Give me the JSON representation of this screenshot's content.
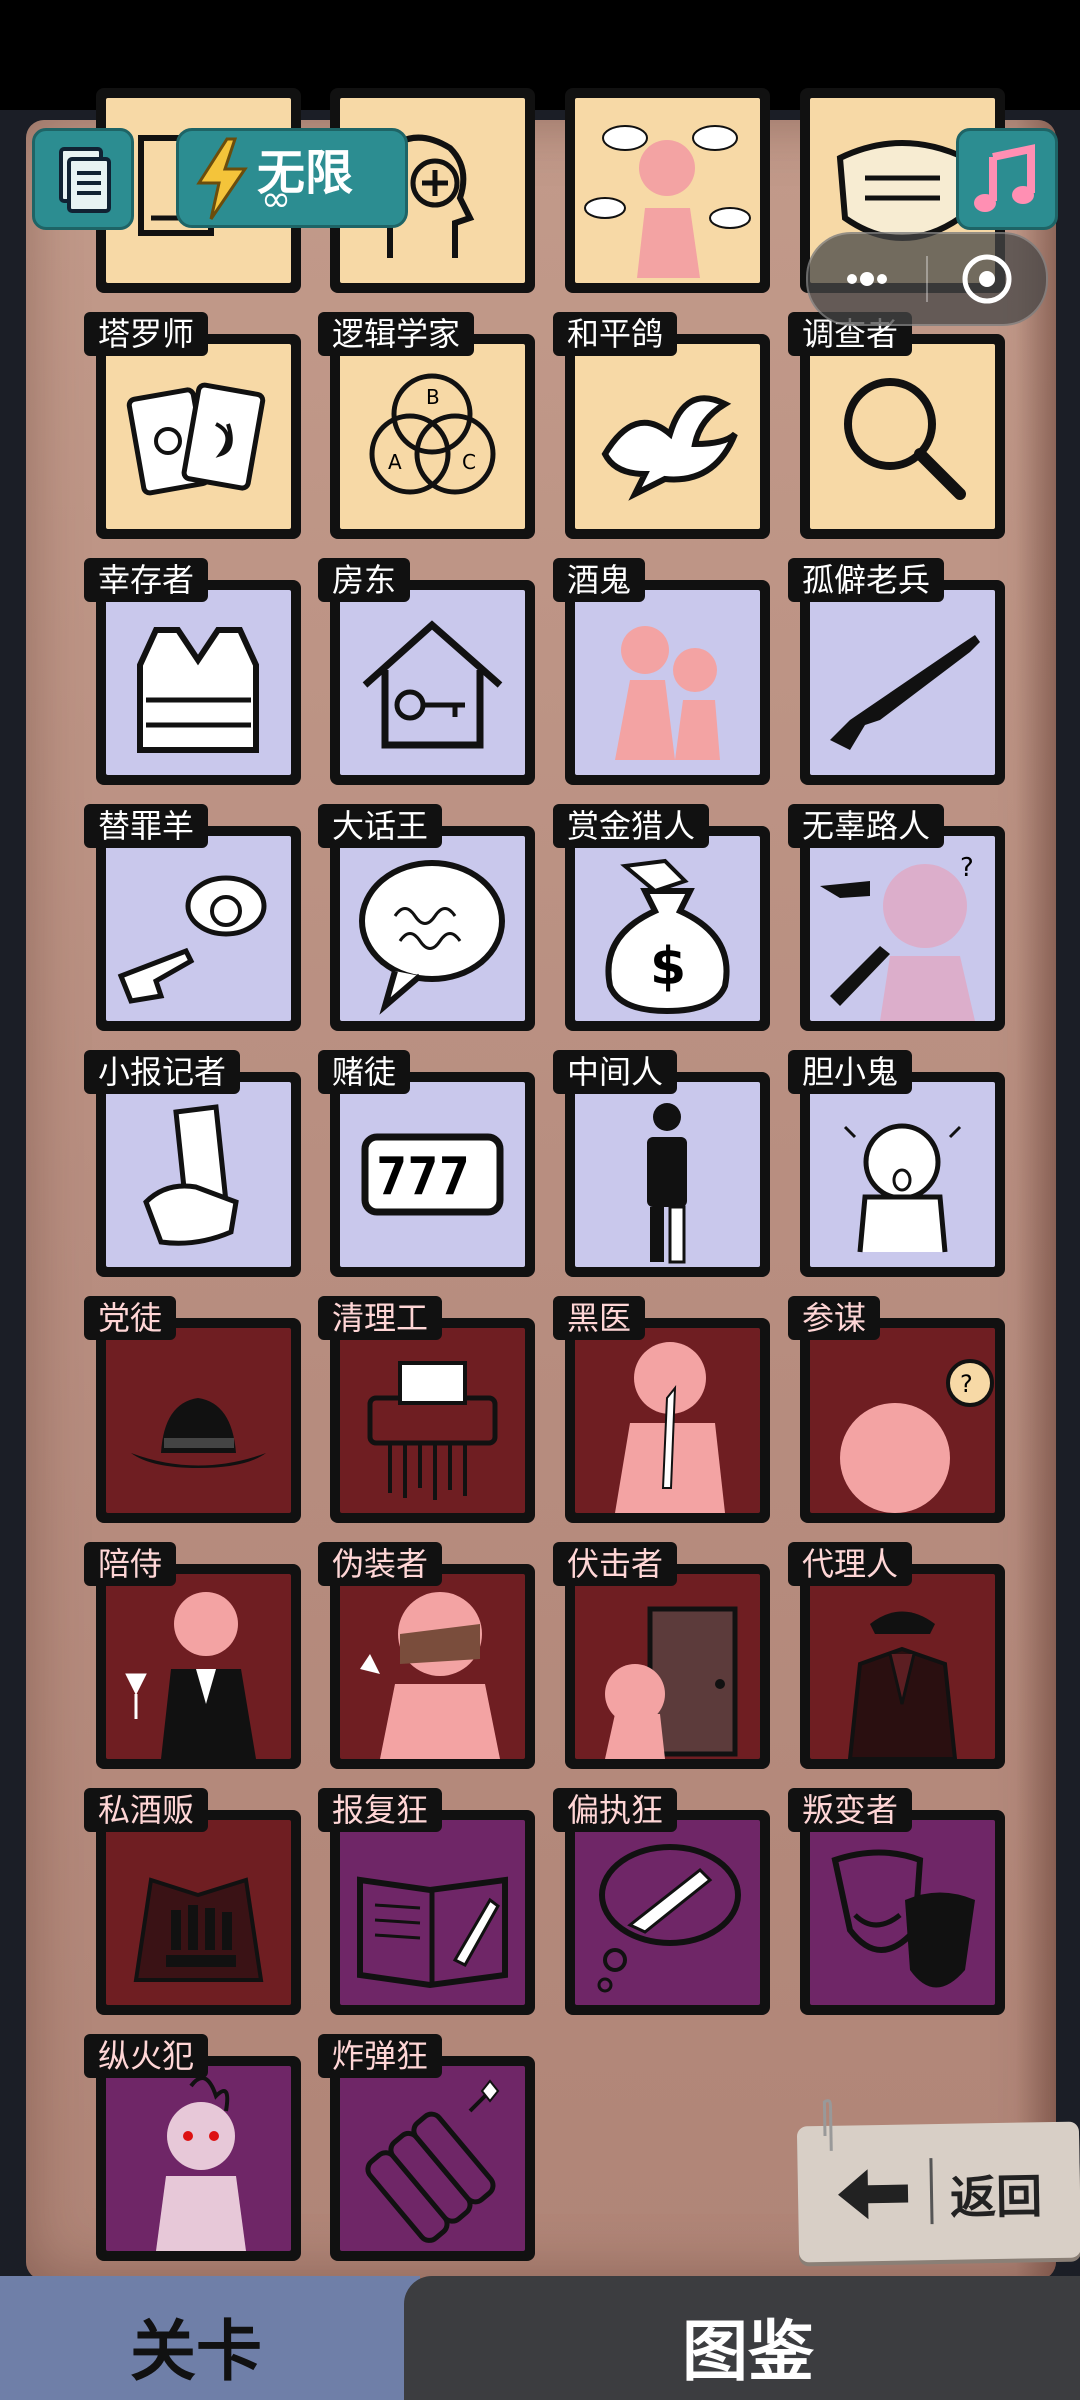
{
  "top_bar": {
    "energy_label": "无限",
    "energy_infinity": "∞"
  },
  "cards": [
    {
      "name": "",
      "color": "yellow",
      "icon": "book-icon"
    },
    {
      "name": "",
      "color": "yellow",
      "icon": "head-plus-icon"
    },
    {
      "name": "",
      "color": "yellow",
      "icon": "gossip-figure-icon"
    },
    {
      "name": "",
      "color": "yellow",
      "icon": "face-mask-icon"
    },
    {
      "name": "塔罗师",
      "color": "yellow",
      "icon": "tarot-cards-icon"
    },
    {
      "name": "逻辑学家",
      "color": "yellow",
      "icon": "venn-diagram-icon"
    },
    {
      "name": "和平鸽",
      "color": "yellow",
      "icon": "dove-icon"
    },
    {
      "name": "调查者",
      "color": "yellow",
      "icon": "magnifier-icon"
    },
    {
      "name": "幸存者",
      "color": "lavender",
      "icon": "vest-icon"
    },
    {
      "name": "房东",
      "color": "lavender",
      "icon": "house-key-icon"
    },
    {
      "name": "酒鬼",
      "color": "lavender",
      "icon": "drunk-figures-icon"
    },
    {
      "name": "孤僻老兵",
      "color": "lavender",
      "icon": "rifle-icon"
    },
    {
      "name": "替罪羊",
      "color": "lavender",
      "icon": "pointing-sheep-icon"
    },
    {
      "name": "大话王",
      "color": "lavender",
      "icon": "speech-bubble-icon"
    },
    {
      "name": "赏金猎人",
      "color": "lavender",
      "icon": "money-bag-icon"
    },
    {
      "name": "无辜路人",
      "color": "lavender",
      "icon": "confused-figure-icon"
    },
    {
      "name": "小报记者",
      "color": "lavender",
      "icon": "newspaper-hand-icon"
    },
    {
      "name": "赌徒",
      "color": "lavender",
      "icon": "slot-777-icon"
    },
    {
      "name": "中间人",
      "color": "lavender",
      "icon": "half-person-icon"
    },
    {
      "name": "胆小鬼",
      "color": "lavender",
      "icon": "scared-face-icon"
    },
    {
      "name": "党徒",
      "color": "red",
      "icon": "fedora-hat-icon"
    },
    {
      "name": "清理工",
      "color": "red",
      "icon": "shredder-icon"
    },
    {
      "name": "黑医",
      "color": "red",
      "icon": "doctor-knife-icon"
    },
    {
      "name": "参谋",
      "color": "red",
      "icon": "idea-bulb-icon"
    },
    {
      "name": "陪侍",
      "color": "red",
      "icon": "waiter-wine-icon"
    },
    {
      "name": "伪装者",
      "color": "red",
      "icon": "disguise-figure-icon"
    },
    {
      "name": "伏击者",
      "color": "red",
      "icon": "door-ambush-icon"
    },
    {
      "name": "代理人",
      "color": "red",
      "icon": "suit-hat-icon"
    },
    {
      "name": "私酒贩",
      "color": "red",
      "icon": "coat-bottles-icon"
    },
    {
      "name": "报复狂",
      "color": "purple",
      "icon": "notebook-knife-icon"
    },
    {
      "name": "偏执狂",
      "color": "purple",
      "icon": "thought-knife-icon"
    },
    {
      "name": "叛变者",
      "color": "purple",
      "icon": "theater-masks-icon"
    },
    {
      "name": "纵火犯",
      "color": "purple",
      "icon": "burning-figure-icon"
    },
    {
      "name": "炸弹狂",
      "color": "purple",
      "icon": "dynamite-icon"
    }
  ],
  "back_button": {
    "label": "返回"
  },
  "tabs": [
    {
      "label": "关卡"
    },
    {
      "label": "图鉴"
    }
  ],
  "colors": {
    "yellow": "#f7d9a6",
    "lavender": "#c9c8ec",
    "red": "#6f1e22",
    "purple": "#6f2667",
    "accent": "#2c8d91"
  }
}
